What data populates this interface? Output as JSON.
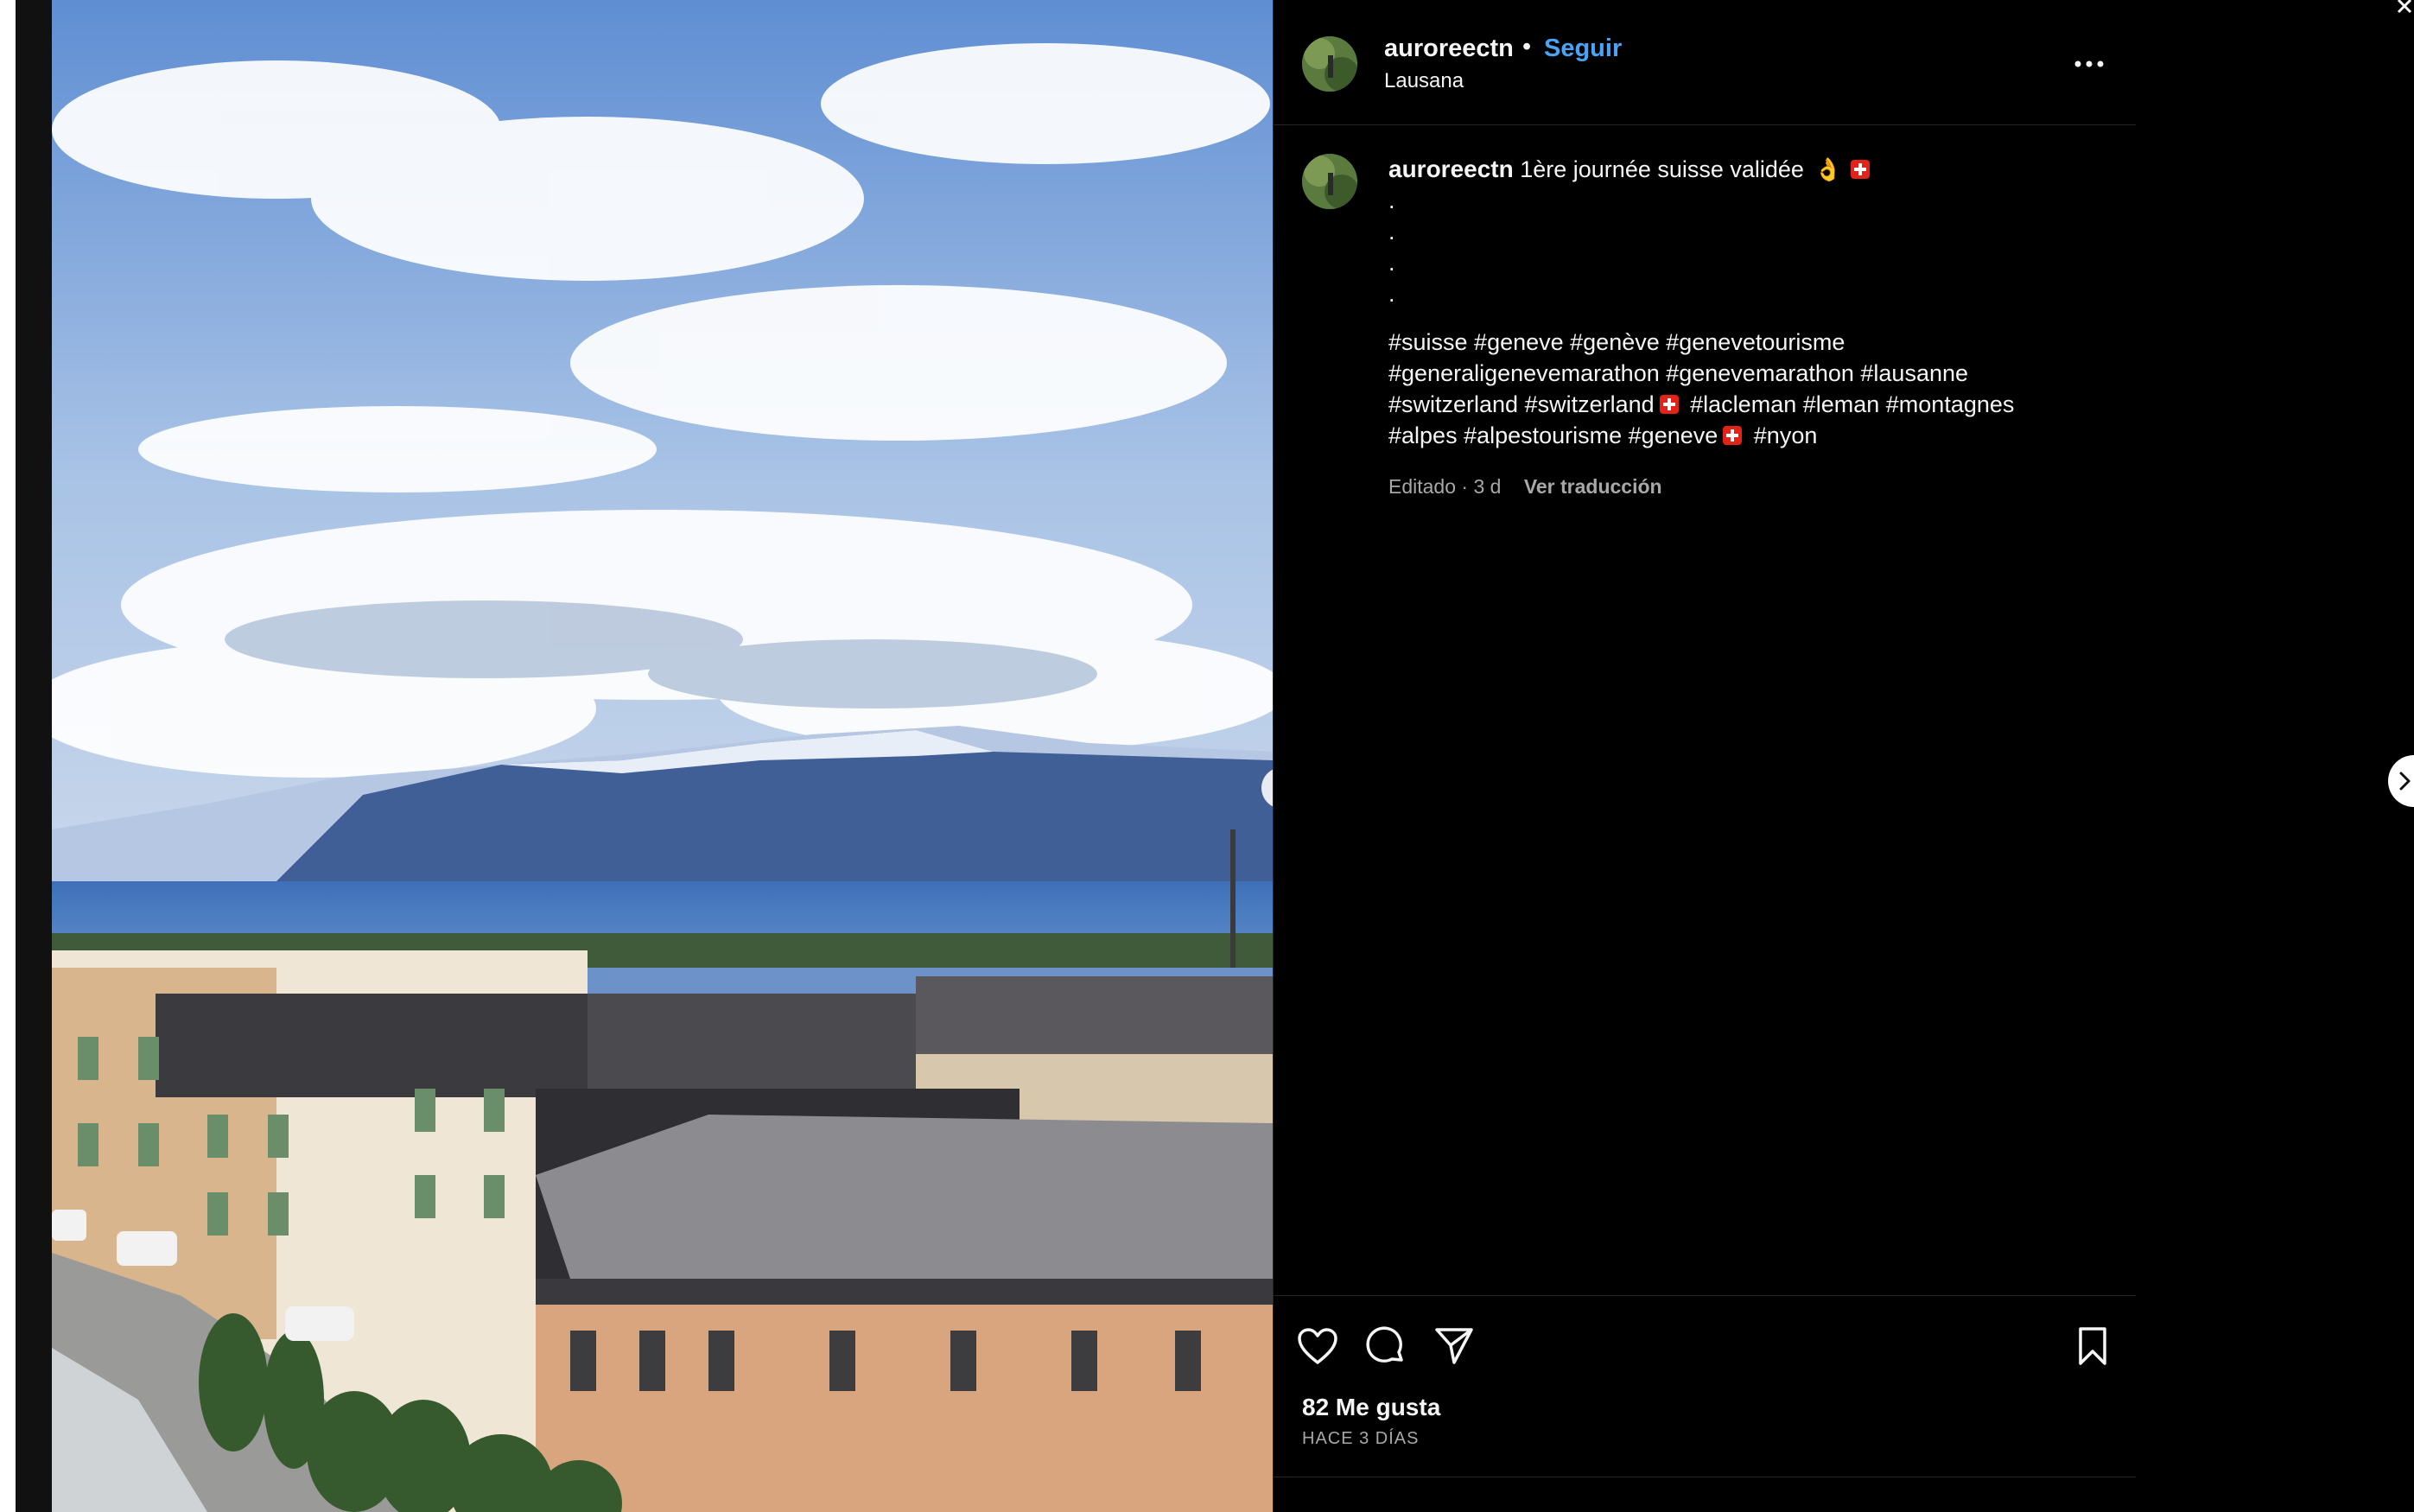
{
  "post": {
    "username": "auroreectn",
    "separator": "•",
    "follow_label": "Seguir",
    "location": "Lausana",
    "caption_text": "1ère journée suisse validée",
    "caption_emoji": "👌",
    "caption_dots": [
      ".",
      ".",
      ".",
      "."
    ],
    "hashtag_lines": [
      "#suisse #geneve #genève #genevetourisme",
      "#generaligenevemarathon #genevemarathon #lausanne",
      "#switzerland #switzerland",
      "#lacleman #leman #montagnes",
      "#alpes #alpestourisme #geneve",
      "#nyon"
    ],
    "edited_label": "Editado · 3 d",
    "translate_label": "Ver traducción",
    "likes_label": "82 Me gusta",
    "time_label": "HACE 3 DÍAS"
  },
  "icons": {
    "more": "more-options-icon",
    "like": "heart-icon",
    "comment": "comment-icon",
    "share": "send-icon",
    "save": "bookmark-icon",
    "photo_next": "chevron-right-icon",
    "post_next": "chevron-right-icon",
    "close": "close-icon"
  },
  "colors": {
    "background": "#000000",
    "text": "#f5f5f5",
    "secondary_text": "#a8a8a8",
    "follow": "#4aa3f5",
    "divider": "#262626",
    "flag_red": "#e2231a"
  }
}
